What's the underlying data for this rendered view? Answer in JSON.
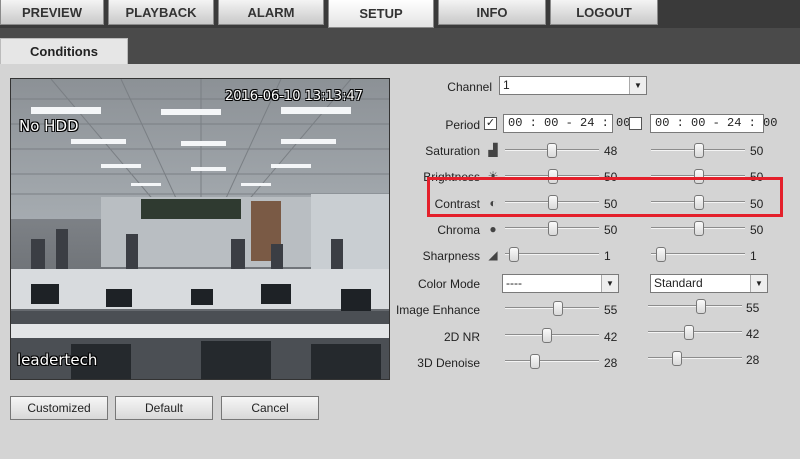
{
  "nav": {
    "tabs": [
      {
        "label": "PREVIEW"
      },
      {
        "label": "PLAYBACK"
      },
      {
        "label": "ALARM"
      },
      {
        "label": "SETUP"
      },
      {
        "label": "INFO"
      },
      {
        "label": "LOGOUT"
      }
    ],
    "active": "SETUP"
  },
  "subtab": "Conditions",
  "preview": {
    "timestamp": "2016-06-10 13:13:47",
    "hdd_status": "No HDD",
    "camera_name": "leadertech"
  },
  "channel": {
    "label": "Channel",
    "value": "1"
  },
  "period": {
    "label": "Period",
    "profile1": {
      "checked": true,
      "value": "00 : 00 - 24 : 00"
    },
    "profile2": {
      "checked": false,
      "value": "00 : 00 - 24 : 00"
    }
  },
  "sliders": [
    {
      "label": "Saturation",
      "icon": "saturation-icon",
      "v1": "48",
      "v2": "50"
    },
    {
      "label": "Brightness",
      "icon": "brightness-icon",
      "v1": "50",
      "v2": "50"
    },
    {
      "label": "Contrast",
      "icon": "contrast-icon",
      "v1": "50",
      "v2": "50"
    },
    {
      "label": "Chroma",
      "icon": "chroma-icon",
      "v1": "50",
      "v2": "50"
    },
    {
      "label": "Sharpness",
      "icon": "sharpness-icon",
      "v1": "1",
      "v2": "1"
    }
  ],
  "color_mode": {
    "label": "Color Mode",
    "v1": "----",
    "v2": "Standard"
  },
  "sliders2": [
    {
      "label": "Image Enhance",
      "v1": "55",
      "v2": "55"
    },
    {
      "label": "2D NR",
      "v1": "42",
      "v2": "42"
    },
    {
      "label": "3D Denoise",
      "v1": "28",
      "v2": "28"
    }
  ],
  "buttons": {
    "customized": "Customized",
    "default": "Default",
    "cancel": "Cancel"
  },
  "colors": {
    "highlight": "#e4202b",
    "topbar": "#3a3a3a"
  }
}
